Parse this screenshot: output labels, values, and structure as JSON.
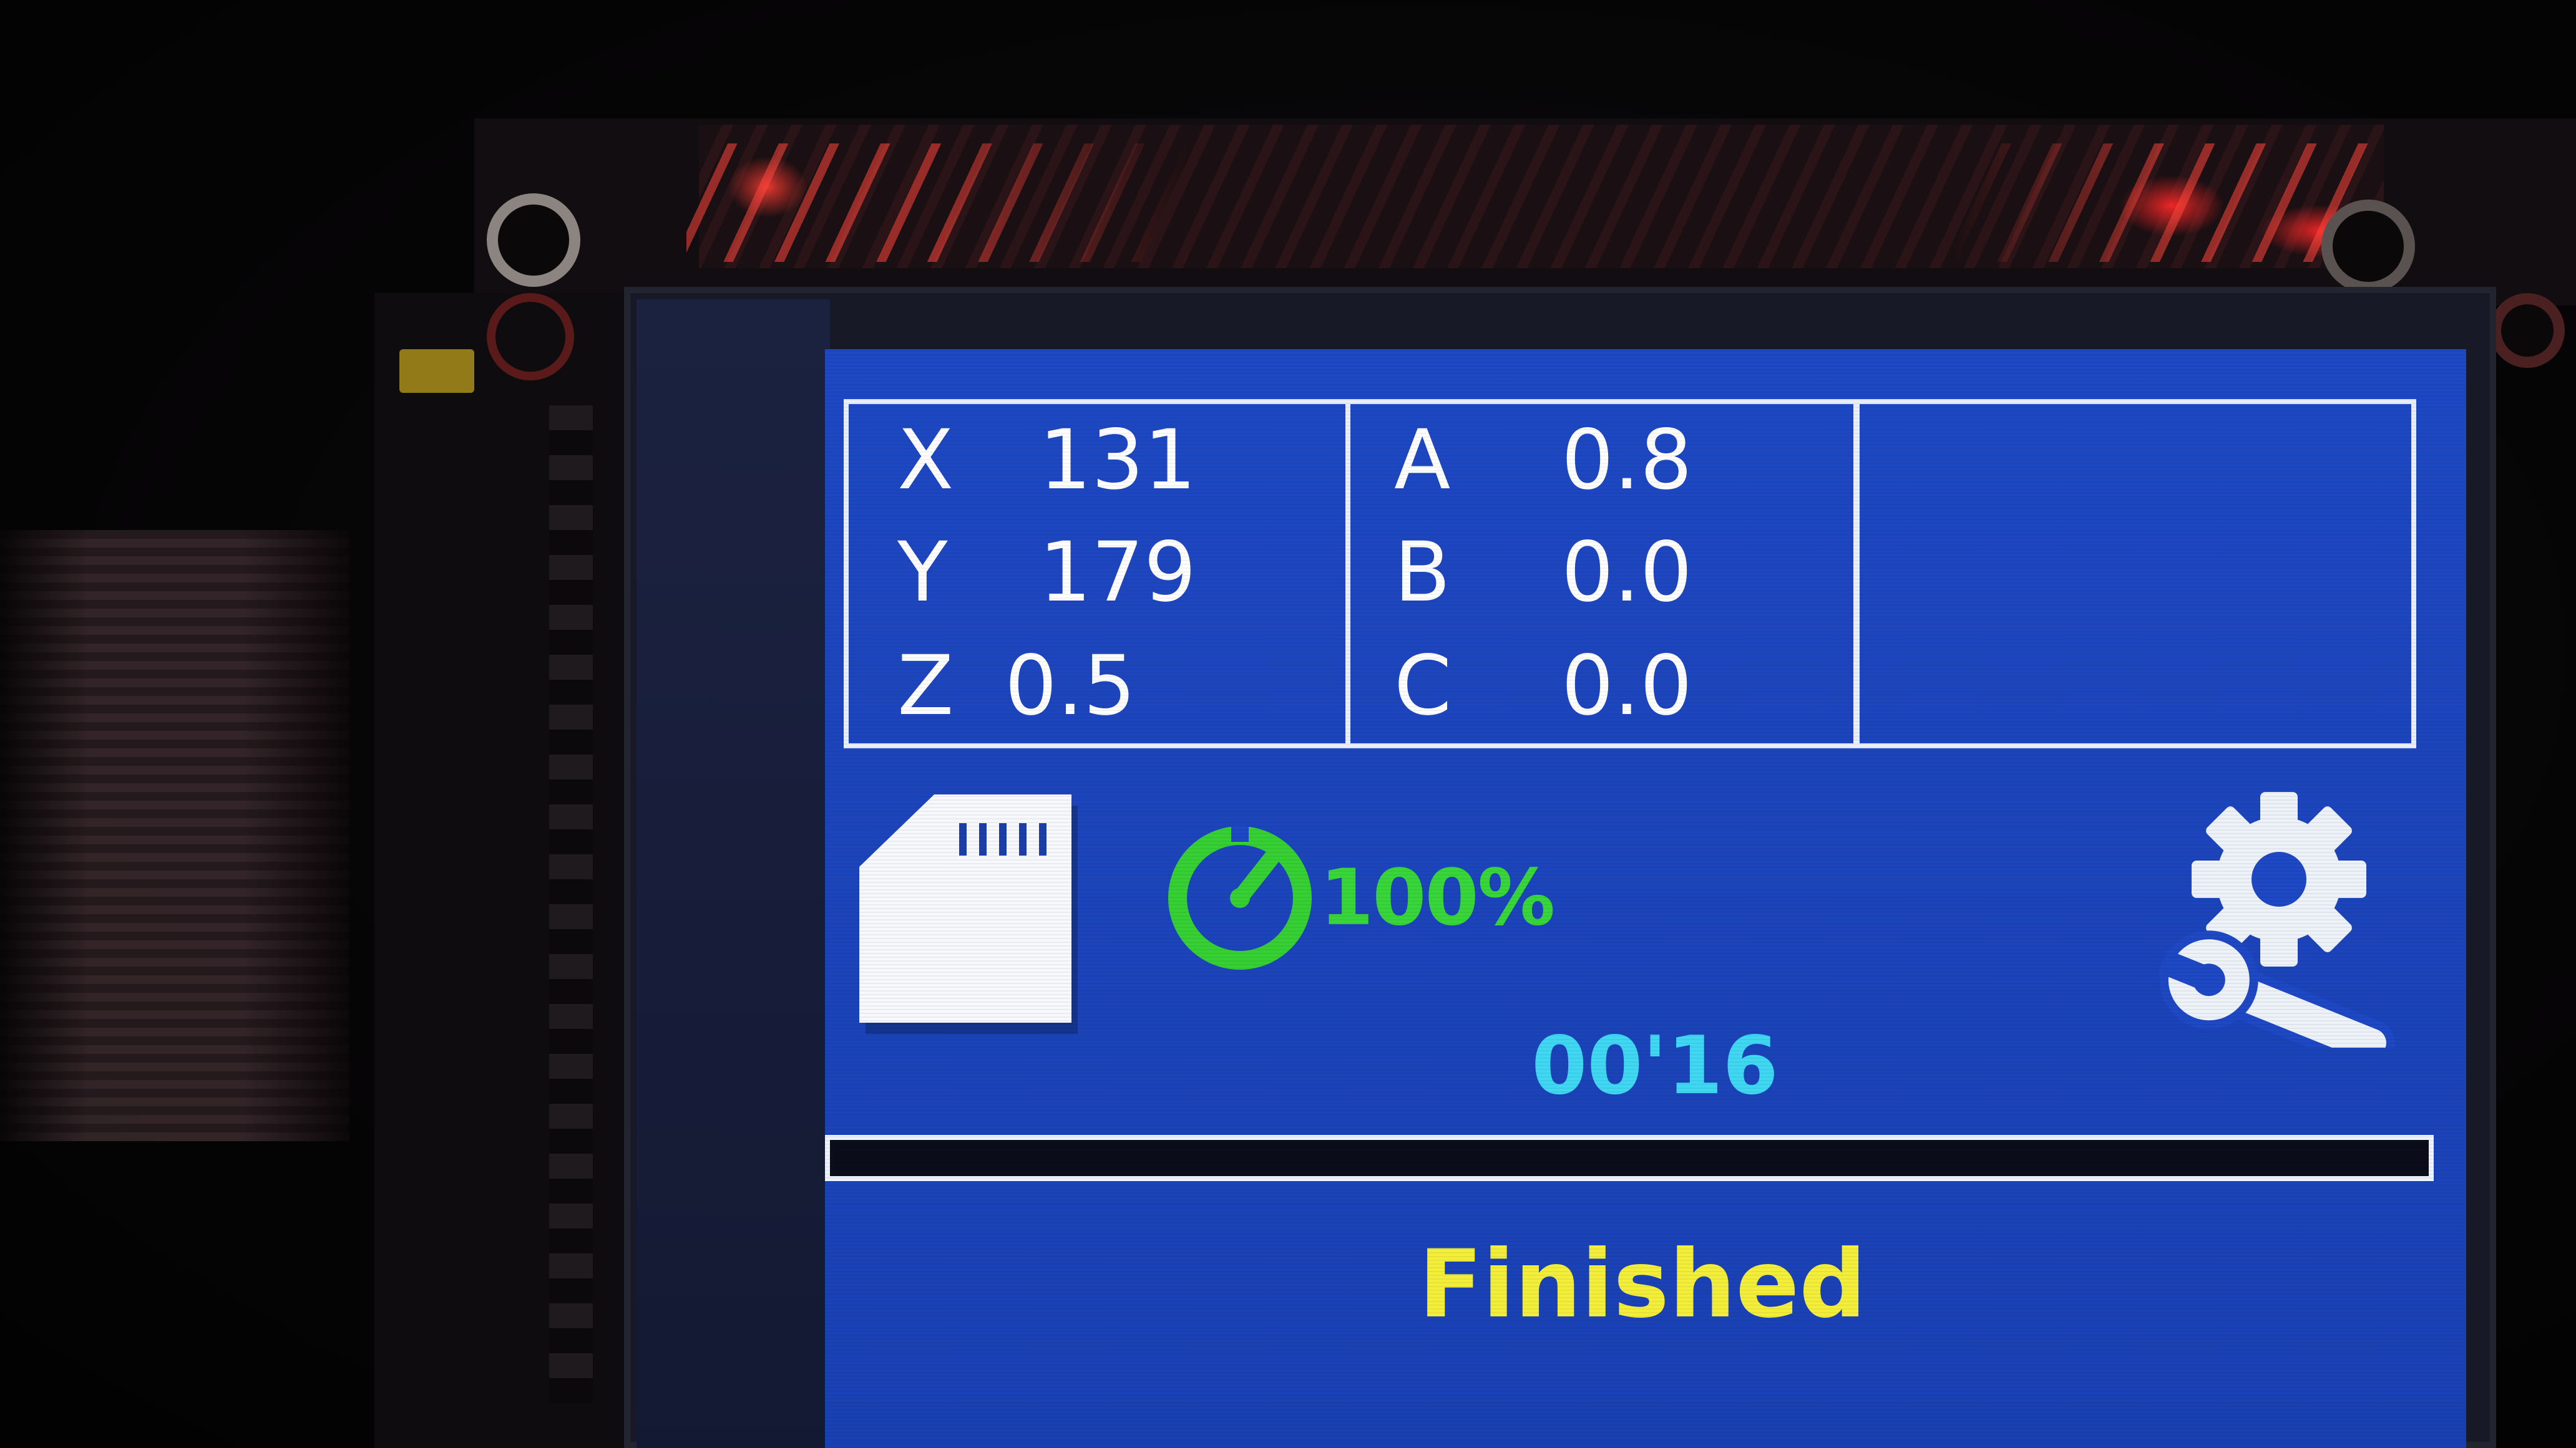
{
  "coordinates": {
    "X": "131",
    "Y": "179",
    "Z": "0.5",
    "A": "0.8",
    "B": "0.0",
    "C": "0.0"
  },
  "print": {
    "percent": "100%",
    "elapsed_time": "00'16",
    "progress_fraction": 1.0,
    "status": "Finished"
  },
  "icons": {
    "storage": "sd-card-icon",
    "progress": "gauge-icon",
    "settings": "settings-icon"
  },
  "colors": {
    "screen_bg": "#1e48c4",
    "axis_text": "#ffffff",
    "percent_text": "#38d63a",
    "time_text": "#3fd7f2",
    "status_text": "#f2ee3a"
  }
}
